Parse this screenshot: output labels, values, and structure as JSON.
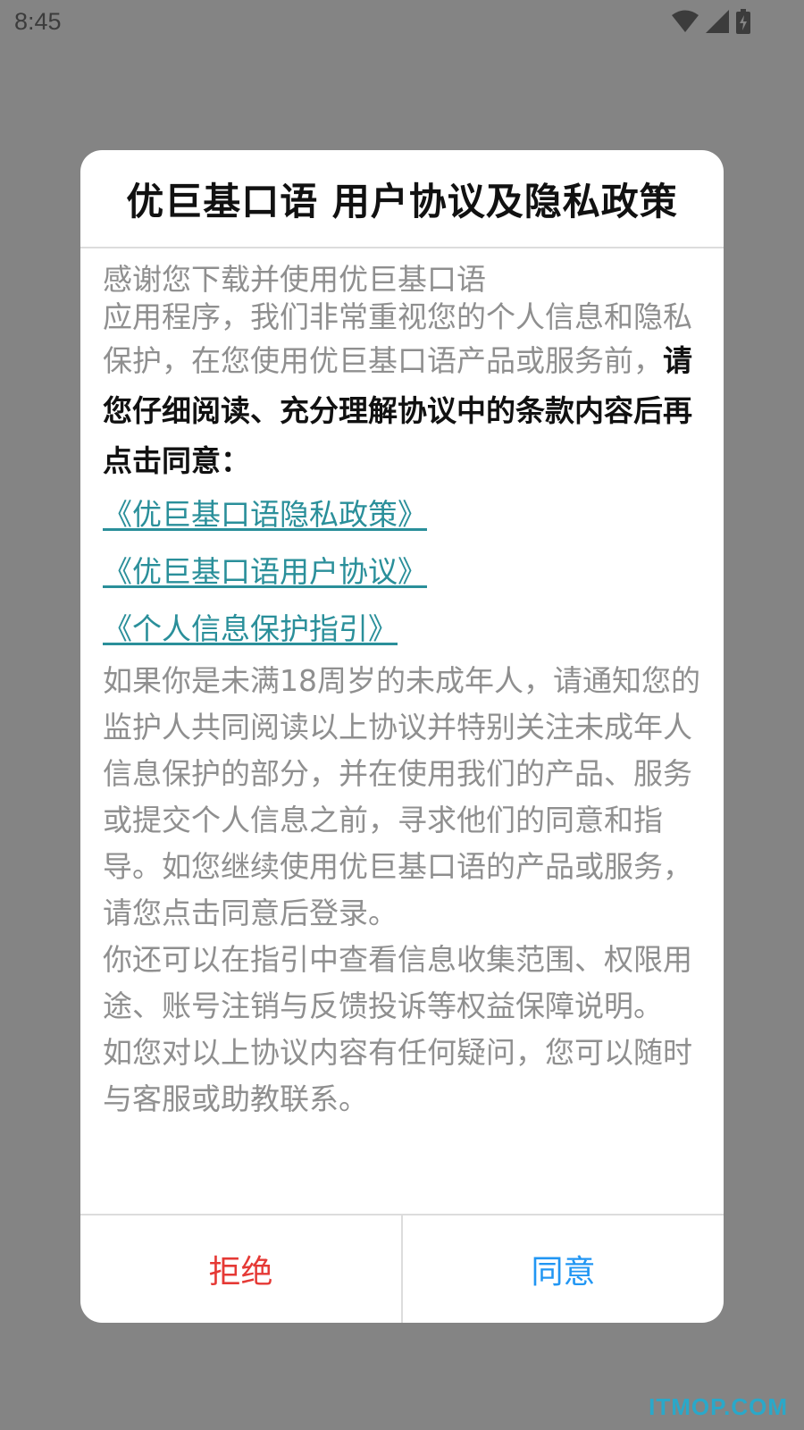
{
  "status_bar": {
    "time": "8:45",
    "icons": [
      "wifi-icon",
      "cellular-signal-icon",
      "battery-charging-icon"
    ]
  },
  "dialog": {
    "title": "优巨基口语 用户协议及隐私政策",
    "intro_line1": "感谢您下载并使用优巨基口语",
    "intro_line2": "应用程序，我们非常重视您的个人信息和隐私保护，在您使用优巨基口语产品或服务前，",
    "intro_emphasis": "请您仔细阅读、充分理解协议中的条款内容后再点击同意：",
    "links": [
      "《优巨基口语隐私政策》",
      "《优巨基口语用户协议》",
      "《个人信息保护指引》"
    ],
    "paragraphs": [
      "如果你是未满18周岁的未成年人，请通知您的监护人共同阅读以上协议并特别关注未成年人信息保护的部分，并在使用我们的产品、服务或提交个人信息之前，寻求他们的同意和指导。如您继续使用优巨基口语的产品或服务，请您点击同意后登录。",
      "你还可以在指引中查看信息收集范围、权限用途、账号注销与反馈投诉等权益保障说明。",
      "如您对以上协议内容有任何疑问，您可以随时与客服或助教联系。"
    ],
    "buttons": {
      "reject": "拒绝",
      "agree": "同意"
    }
  },
  "colors": {
    "overlay": "#848484",
    "link": "#2a8f9a",
    "reject": "#e53935",
    "agree": "#2196f3",
    "watermark": "#2aa8c9"
  },
  "watermark": "ITMOP.COM"
}
